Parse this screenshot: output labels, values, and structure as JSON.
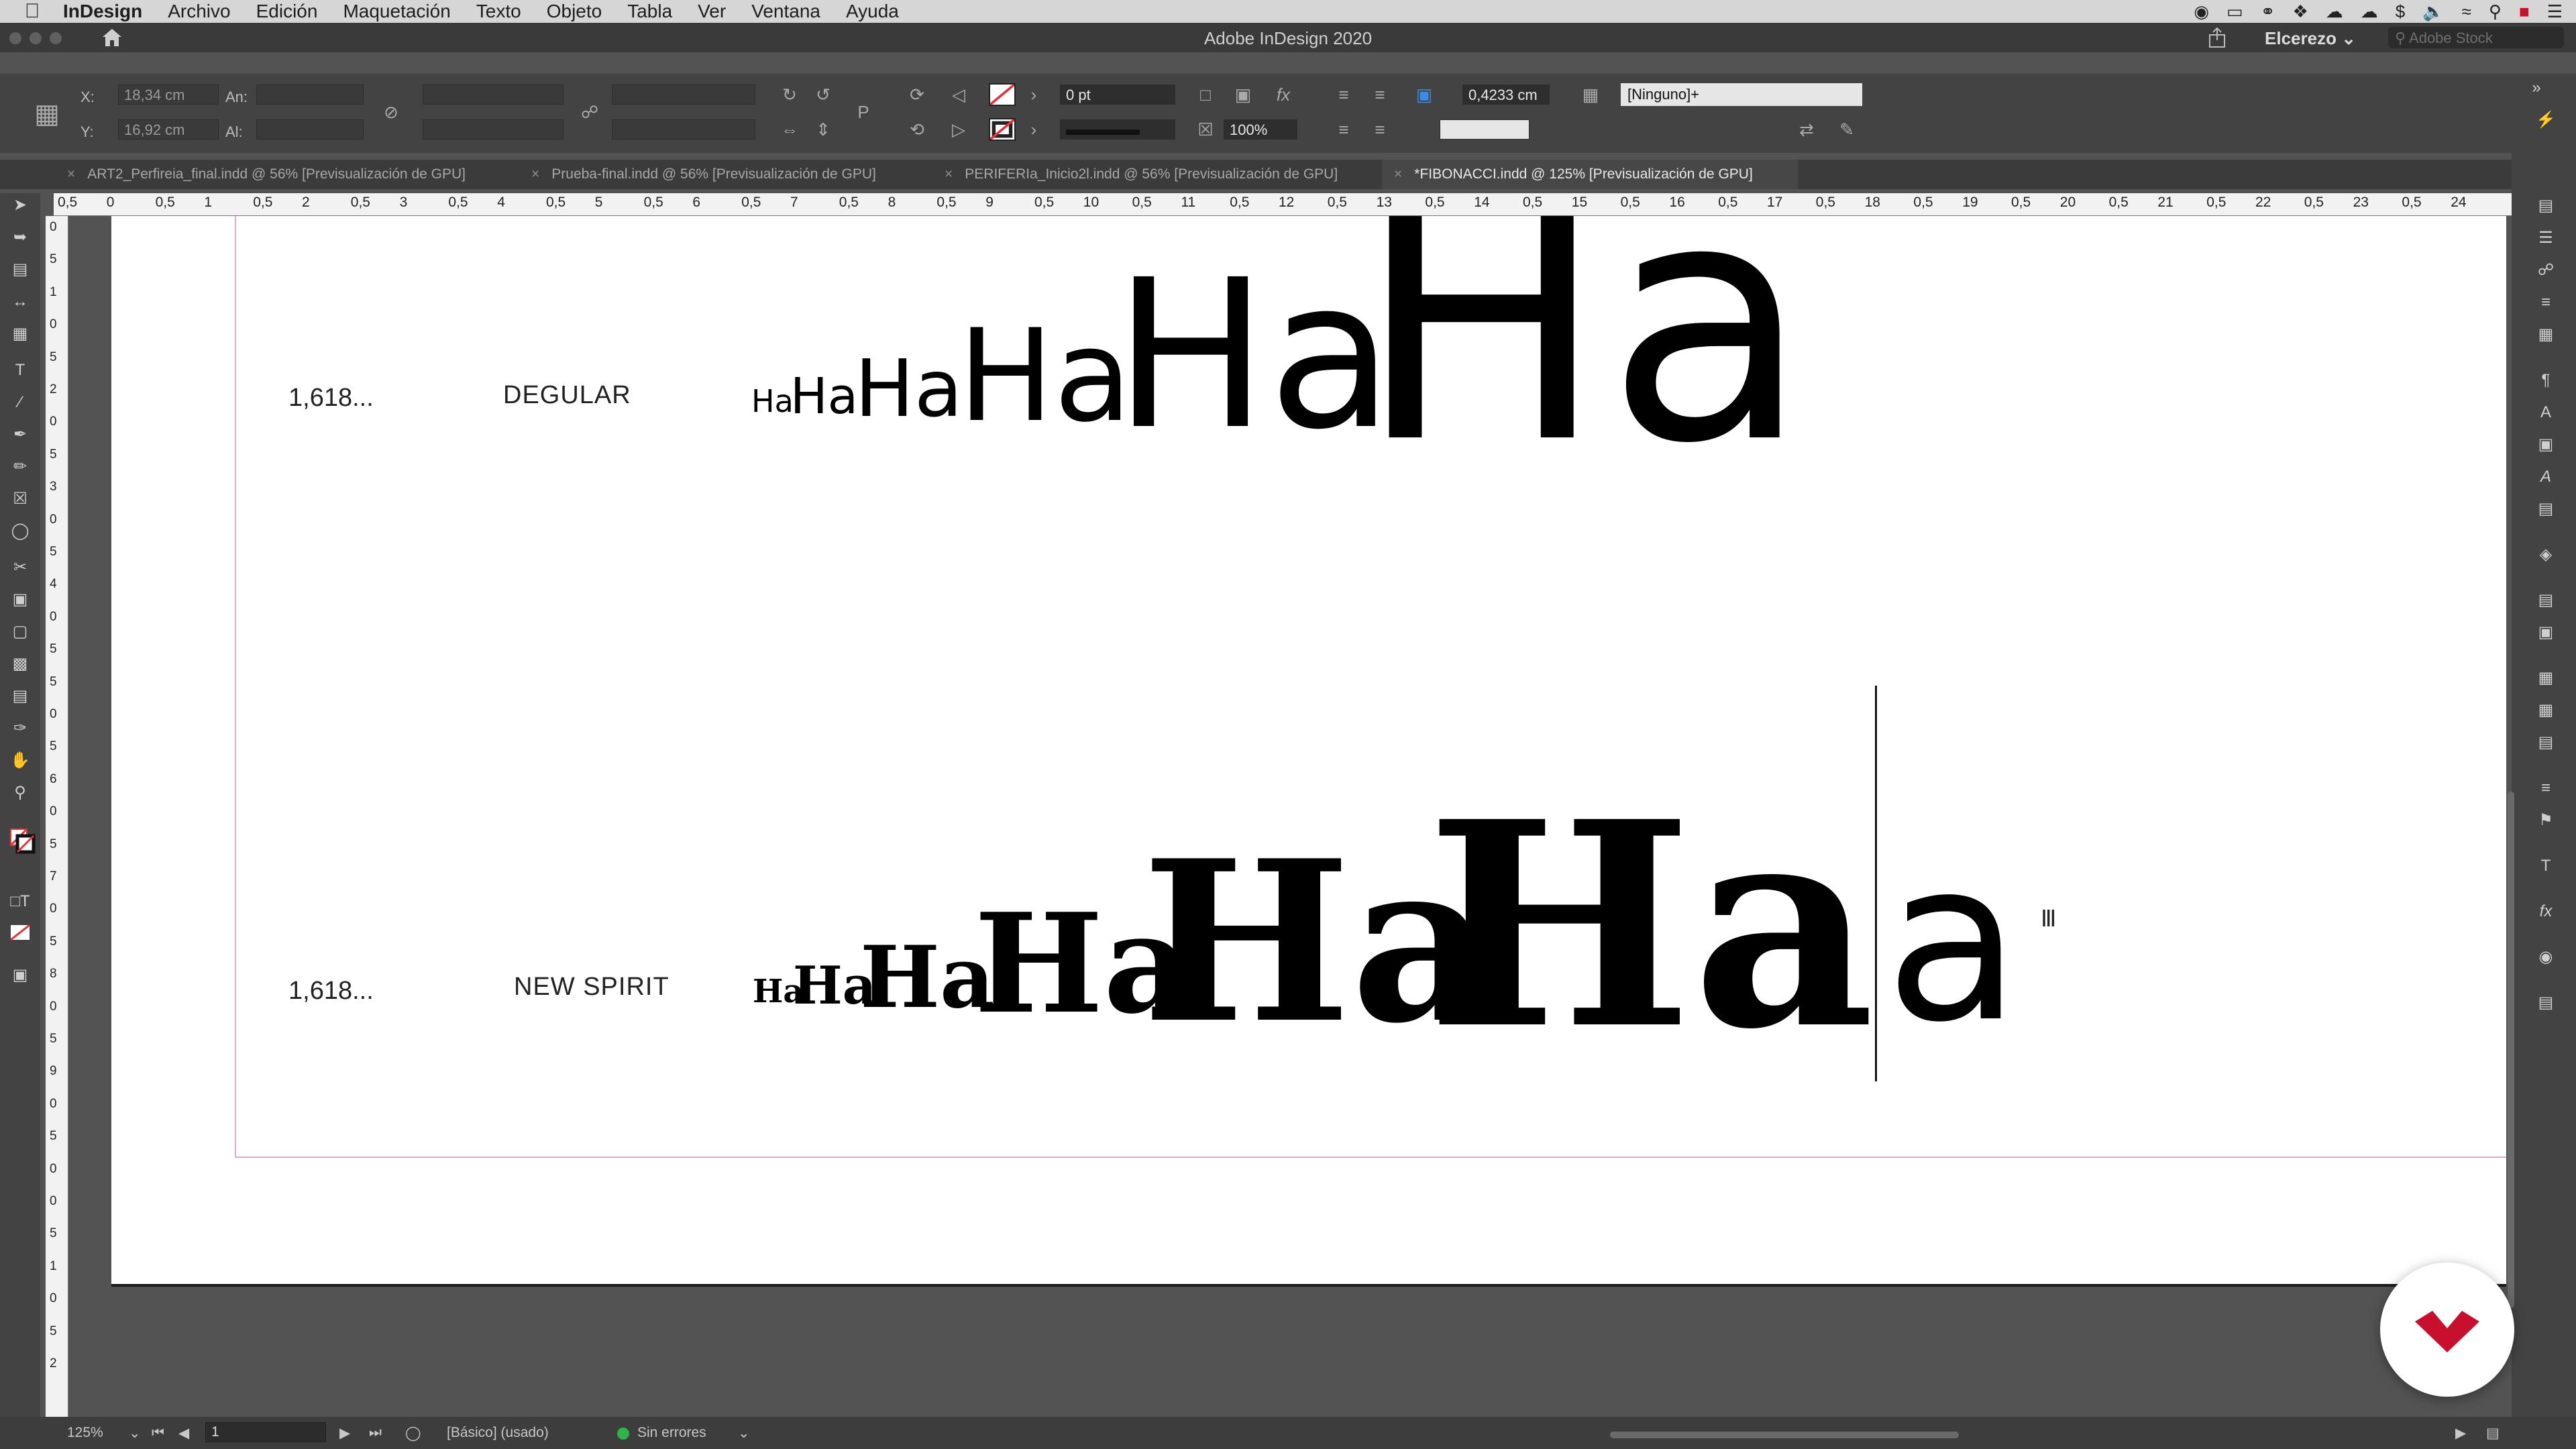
{
  "menubar": {
    "app": "InDesign",
    "items": [
      "Archivo",
      "Edición",
      "Maquetación",
      "Texto",
      "Objeto",
      "Tabla",
      "Ver",
      "Ventana",
      "Ayuda"
    ]
  },
  "window": {
    "title": "Adobe InDesign 2020",
    "workspace": "Elcerezo",
    "stock_placeholder": "Adobe Stock"
  },
  "control": {
    "x_label": "X:",
    "x_value": "18,34 cm",
    "y_label": "Y:",
    "y_value": "16,92 cm",
    "w_label": "An:",
    "h_label": "Al:",
    "stroke_weight": "0 pt",
    "scale": "100%",
    "offset": "0,4233 cm",
    "object_style": "[Ninguno]+"
  },
  "tabs": [
    {
      "label": "ART2_Perfireia_final.indd @ 56% [Previsualización de GPU]",
      "active": false
    },
    {
      "label": "Prueba-final.indd @ 56% [Previsualización de GPU]",
      "active": false
    },
    {
      "label": "PERIFERIa_Inicio2l.indd @ 56% [Previsualización de GPU]",
      "active": false
    },
    {
      "label": "*FIBONACCI.indd @ 125% [Previsualización de GPU]",
      "active": true
    }
  ],
  "ruler_h": [
    "0,5",
    "0",
    "0,5",
    "1",
    "0,5",
    "2",
    "0,5",
    "3",
    "0,5",
    "4",
    "0,5",
    "5",
    "0,5",
    "6",
    "0,5",
    "7",
    "0,5",
    "8",
    "0,5",
    "9",
    "0,5",
    "10",
    "0,5",
    "11",
    "0,5",
    "12",
    "0,5",
    "13",
    "0,5",
    "14",
    "0,5",
    "15",
    "0,5",
    "16",
    "0,5",
    "17",
    "0,5",
    "18",
    "0,5",
    "19",
    "0,5",
    "20",
    "0,5",
    "21",
    "0,5",
    "22",
    "0,5",
    "23",
    "0,5",
    "24"
  ],
  "ruler_v": [
    "0",
    "5",
    "1",
    "0",
    "5",
    "2",
    "0",
    "5",
    "3",
    "0",
    "5",
    "4",
    "0",
    "5",
    "5",
    "0",
    "5",
    "6",
    "0",
    "5",
    "7",
    "0",
    "5",
    "8",
    "0",
    "5",
    "9",
    "0",
    "5",
    "0",
    "0",
    "5",
    "1",
    "0",
    "5",
    "2"
  ],
  "specimens": [
    {
      "ratio": "1,618...",
      "font": "DEGULAR",
      "sample": "Ha"
    },
    {
      "ratio": "1,618...",
      "font": "NEW SPIRIT",
      "sample": "Ha",
      "tail": "a"
    }
  ],
  "status": {
    "zoom": "125%",
    "page": "1",
    "profile": "[Básico] (usado)",
    "preflight": "Sin errores"
  },
  "colors": {
    "accent_stroke": "#e4313a",
    "margin_guide": "#e2a7dd",
    "preflight_ok": "#2fb34a",
    "logo_red": "#c8102e"
  }
}
